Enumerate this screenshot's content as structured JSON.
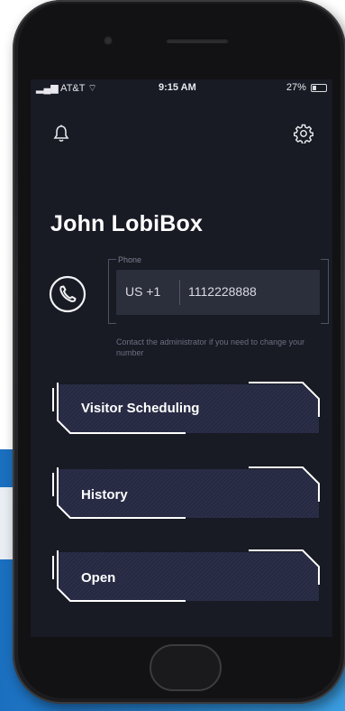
{
  "status_bar": {
    "carrier": "AT&T",
    "time": "9:15 AM",
    "battery": "27%",
    "battery_level": 0.27
  },
  "header": {
    "bell_icon": "bell-icon",
    "settings_icon": "gear-icon"
  },
  "profile": {
    "name": "John LobiBox"
  },
  "phone": {
    "label": "Phone",
    "country_code": "US +1",
    "number": "1112228888",
    "icon": "phone-icon",
    "note": "Contact the administrator if you need to change your number"
  },
  "menu": [
    {
      "label": "Visitor Scheduling"
    },
    {
      "label": "History"
    },
    {
      "label": "Open"
    }
  ],
  "colors": {
    "screen_bg": "#181a24",
    "button_fill": "#2a2d45",
    "accent": "#ffffff"
  }
}
